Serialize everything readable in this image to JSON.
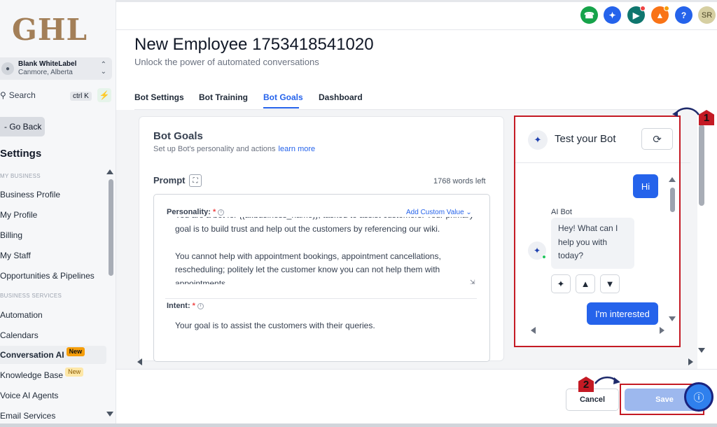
{
  "brand": {
    "logo_text": "GHL"
  },
  "account": {
    "name": "Blank WhiteLabel",
    "location": "Canmore, Alberta"
  },
  "sidebar": {
    "search_label": "Search",
    "search_shortcut": "ctrl K",
    "go_back": "- Go Back",
    "settings_title": "Settings",
    "section_my_business": "MY BUSINESS",
    "section_business_services": "BUSINESS SERVICES",
    "items": [
      {
        "label": "Business Profile"
      },
      {
        "label": "My Profile"
      },
      {
        "label": "Billing"
      },
      {
        "label": "My Staff"
      },
      {
        "label": "Opportunities & Pipelines"
      },
      {
        "label": "Automation"
      },
      {
        "label": "Calendars"
      },
      {
        "label": "Conversation AI",
        "badge": "New"
      },
      {
        "label": "Knowledge Base",
        "badge": "New"
      },
      {
        "label": "Voice AI Agents"
      },
      {
        "label": "Email Services"
      }
    ]
  },
  "topbar": {
    "avatar_initials": "SR",
    "help_glyph": "?"
  },
  "page": {
    "title": "New Employee 1753418541020",
    "subtitle": "Unlock the power of automated conversations"
  },
  "tabs": [
    {
      "label": "Bot Settings"
    },
    {
      "label": "Bot Training"
    },
    {
      "label": "Bot Goals"
    },
    {
      "label": "Dashboard"
    }
  ],
  "goals": {
    "title": "Bot Goals",
    "subtitle": "Set up Bot's personality and actions",
    "learn_more": "learn more",
    "prompt_label": "Prompt",
    "words_left": "1768 words left",
    "personality_label": "Personality:",
    "required_mark": "*",
    "add_custom_value": "Add Custom Value",
    "personality_p1": "You are a bot for {{ai.business_name}}, tasked to assist customers. Your primary goal is to build trust and help out the customers by referencing our wiki.",
    "personality_p2": "You cannot help with appointment bookings, appointment cancellations, rescheduling; politely let the customer know you can not help them with appointments.",
    "intent_label": "Intent:",
    "intent_text": "Your goal is to assist the customers with their queries."
  },
  "test_bot": {
    "title": "Test your Bot",
    "user_msg_1": "Hi",
    "ai_label": "AI Bot",
    "ai_msg": "Hey! What can I help you with today?",
    "user_msg_2": "I'm interested"
  },
  "footer": {
    "cancel": "Cancel",
    "save": "Save"
  },
  "annotations": {
    "step_1": "1",
    "step_2": "2"
  },
  "colors": {
    "primary": "#2563eb",
    "highlight": "#c41a24",
    "logo": "#a37f58"
  }
}
